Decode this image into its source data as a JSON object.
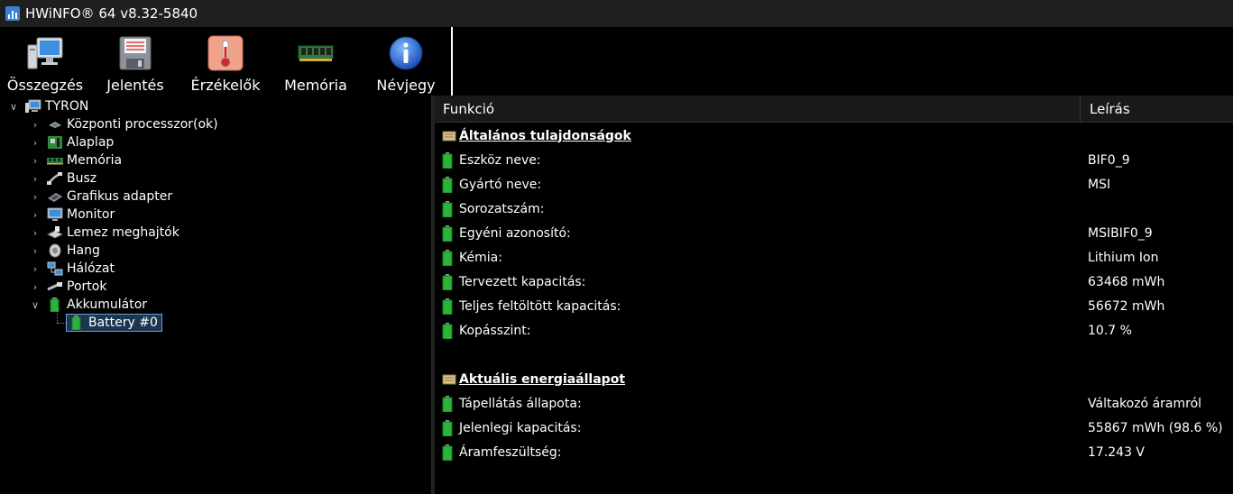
{
  "window": {
    "title": "HWiNFO® 64 v8.32-5840"
  },
  "toolbar": {
    "buttons": [
      {
        "label": "Összegzés",
        "icon": "computer-icon"
      },
      {
        "label": "Jelentés",
        "icon": "floppy-disk-icon"
      },
      {
        "label": "Érzékelők",
        "icon": "thermometer-icon"
      },
      {
        "label": "Memória",
        "icon": "memory-module-icon"
      },
      {
        "label": "Névjegy",
        "icon": "info-icon"
      }
    ]
  },
  "tree": {
    "root": {
      "label": "TYRON",
      "icon": "computer-icon"
    },
    "items": [
      {
        "label": "Központi processzor(ok)",
        "icon": "cpu-icon"
      },
      {
        "label": "Alaplap",
        "icon": "motherboard-icon"
      },
      {
        "label": "Memória",
        "icon": "memory-module-icon"
      },
      {
        "label": "Busz",
        "icon": "bus-icon"
      },
      {
        "label": "Grafikus adapter",
        "icon": "graphics-card-icon"
      },
      {
        "label": "Monitor",
        "icon": "monitor-icon"
      },
      {
        "label": "Lemez meghajtók",
        "icon": "disk-drive-icon"
      },
      {
        "label": "Hang",
        "icon": "speaker-icon"
      },
      {
        "label": "Hálózat",
        "icon": "network-icon"
      },
      {
        "label": "Portok",
        "icon": "port-icon"
      },
      {
        "label": "Akkumulátor",
        "icon": "battery-icon"
      }
    ],
    "child": {
      "label": "Battery #0",
      "icon": "battery-icon"
    }
  },
  "detail": {
    "columns": {
      "feature": "Funkció",
      "description": "Leírás"
    },
    "sections": [
      {
        "title": "Általános tulajdonságok",
        "rows": [
          {
            "label": "Eszköz neve:",
            "value": "BIF0_9"
          },
          {
            "label": "Gyártó neve:",
            "value": "MSI"
          },
          {
            "label": "Sorozatszám:",
            "value": ""
          },
          {
            "label": "Egyéni azonosító:",
            "value": "MSIBIF0_9"
          },
          {
            "label": "Kémia:",
            "value": "Lithium Ion"
          },
          {
            "label": "Tervezett kapacitás:",
            "value": "63468 mWh"
          },
          {
            "label": "Teljes feltöltött kapacitás:",
            "value": "56672 mWh"
          },
          {
            "label": "Kopásszint:",
            "value": "10.7 %"
          }
        ]
      },
      {
        "title": "Aktuális energiaállapot",
        "rows": [
          {
            "label": "Tápellátás állapota:",
            "value": "Váltakozó áramról"
          },
          {
            "label": "Jelenlegi kapacitás:",
            "value": "55867 mWh (98.6 %)"
          },
          {
            "label": "Áramfeszültség:",
            "value": "17.243 V"
          }
        ]
      }
    ]
  },
  "colors": {
    "background": "#000000",
    "battery_green": "#2bb43a",
    "selection": "#1c3550"
  }
}
